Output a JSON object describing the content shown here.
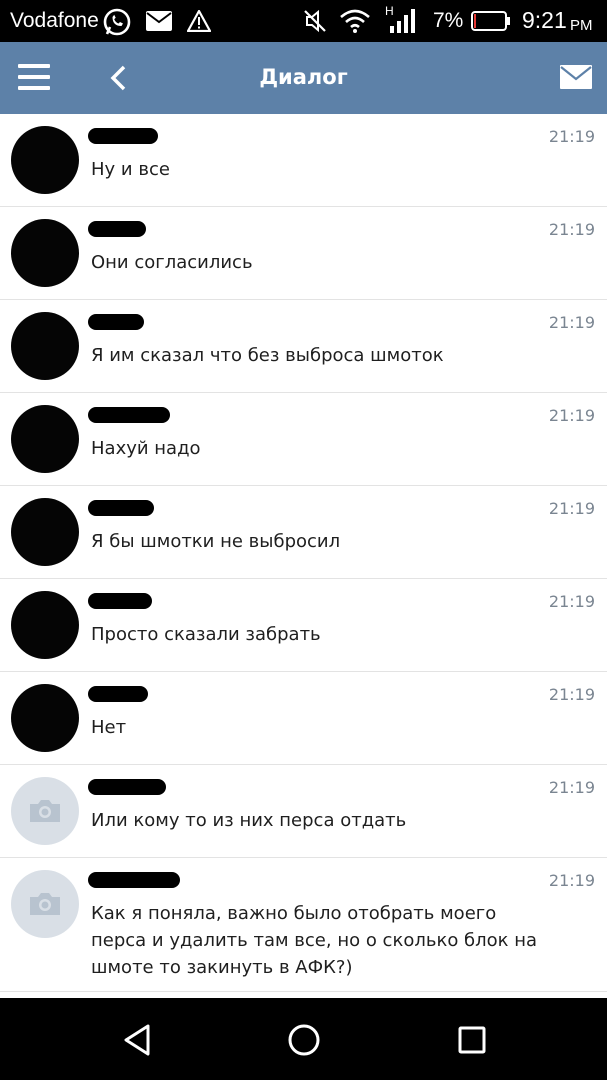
{
  "status_bar": {
    "carrier": "Vodafone",
    "battery_percent": "7%",
    "battery_level": 0.07,
    "battery_color": "#e53935",
    "time_digits": "9:21",
    "time_suffix": "PM",
    "network_label": "H",
    "icons": [
      "whatsapp-icon",
      "mail-icon",
      "warning-icon",
      "mute-icon",
      "wifi-icon",
      "signal-icon",
      "battery-icon"
    ]
  },
  "header": {
    "title": "Диалог",
    "background": "#5d81a8"
  },
  "messages": [
    {
      "time": "21:19",
      "text": "Ну и все",
      "avatar": "hidden"
    },
    {
      "time": "21:19",
      "text": "Они согласились",
      "avatar": "hidden"
    },
    {
      "time": "21:19",
      "text": "Я им сказал что без выброса шмоток",
      "avatar": "hidden"
    },
    {
      "time": "21:19",
      "text": "Нахуй надо",
      "avatar": "hidden"
    },
    {
      "time": "21:19",
      "text": "Я бы шмотки не выбросил",
      "avatar": "hidden"
    },
    {
      "time": "21:19",
      "text": "Просто сказали забрать",
      "avatar": "hidden"
    },
    {
      "time": "21:19",
      "text": "Нет",
      "avatar": "hidden"
    },
    {
      "time": "21:19",
      "text": "Или кому то из них перса отдать",
      "avatar": "camera"
    },
    {
      "time": "21:19",
      "text_lines": [
        "Как я поняла, важно было отобрать моего",
        "перса и удалить там все, но о сколько блок на",
        "шмоте то закинуть в АФК?)"
      ],
      "avatar": "camera"
    }
  ],
  "nav": {
    "icons": [
      "back-triangle-icon",
      "home-circle-icon",
      "recents-square-icon"
    ]
  }
}
